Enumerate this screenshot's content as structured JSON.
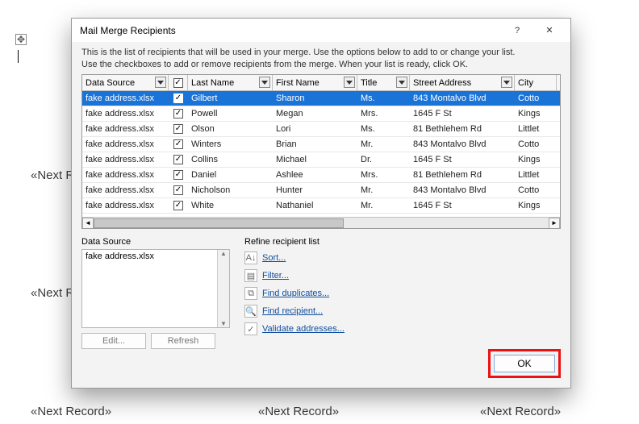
{
  "bg_fields": {
    "a": "«Next Reco",
    "b": "«Next Reco",
    "c": "«Next Record»",
    "d": "«Next Record»",
    "e": "«Next Record»"
  },
  "anchor_glyph": "✥",
  "dialog": {
    "title": "Mail Merge Recipients",
    "help_glyph": "?",
    "close_glyph": "✕",
    "intro_line1": "This is the list of recipients that will be used in your merge.  Use the options below to add to or change your list.",
    "intro_line2": "Use the checkboxes to add or remove recipients from the merge.  When your list is ready, click OK.",
    "headers": {
      "data_source": "Data Source",
      "last_name": "Last Name",
      "first_name": "First Name",
      "title": "Title",
      "street_address": "Street Address",
      "city": "City"
    },
    "rows": [
      {
        "ds": "fake address.xlsx",
        "chk": true,
        "ln": "Gilbert",
        "fn": "Sharon",
        "tl": "Ms.",
        "sa": "843 Montalvo Blvd",
        "ct": "Cotto",
        "sel": true
      },
      {
        "ds": "fake address.xlsx",
        "chk": true,
        "ln": "Powell",
        "fn": "Megan",
        "tl": "Mrs.",
        "sa": "1645 F St",
        "ct": "Kings"
      },
      {
        "ds": "fake address.xlsx",
        "chk": true,
        "ln": "Olson",
        "fn": "Lori",
        "tl": "Ms.",
        "sa": "81 Bethlehem Rd",
        "ct": "Littlet"
      },
      {
        "ds": "fake address.xlsx",
        "chk": true,
        "ln": "Winters",
        "fn": "Brian",
        "tl": "Mr.",
        "sa": "843 Montalvo Blvd",
        "ct": "Cotto"
      },
      {
        "ds": "fake address.xlsx",
        "chk": true,
        "ln": "Collins",
        "fn": "Michael",
        "tl": "Dr.",
        "sa": "1645 F St",
        "ct": "Kings"
      },
      {
        "ds": "fake address.xlsx",
        "chk": true,
        "ln": "Daniel",
        "fn": "Ashlee",
        "tl": "Mrs.",
        "sa": "81 Bethlehem Rd",
        "ct": "Littlet"
      },
      {
        "ds": "fake address.xlsx",
        "chk": true,
        "ln": "Nicholson",
        "fn": "Hunter",
        "tl": "Mr.",
        "sa": "843 Montalvo Blvd",
        "ct": "Cotto"
      },
      {
        "ds": "fake address.xlsx",
        "chk": true,
        "ln": "White",
        "fn": "Nathaniel",
        "tl": "Mr.",
        "sa": "1645 F St",
        "ct": "Kings"
      }
    ],
    "ds_group": {
      "label": "Data Source",
      "item": "fake address.xlsx",
      "edit": "Edit...",
      "refresh": "Refresh"
    },
    "refine": {
      "label": "Refine recipient list",
      "items": [
        {
          "icon": "A↓",
          "label": "Sort..."
        },
        {
          "icon": "▤",
          "label": "Filter..."
        },
        {
          "icon": "⧉",
          "label": "Find duplicates..."
        },
        {
          "icon": "🔍",
          "label": "Find recipient..."
        },
        {
          "icon": "✓",
          "label": "Validate addresses..."
        }
      ]
    },
    "ok": "OK"
  },
  "checkmark": "✓"
}
